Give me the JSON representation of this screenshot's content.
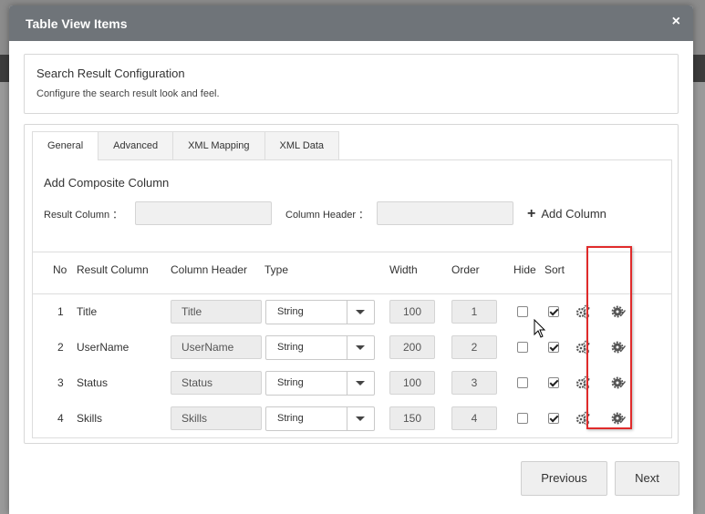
{
  "modal": {
    "title": "Table View Items",
    "close_glyph": "×"
  },
  "config": {
    "title": "Search Result Configuration",
    "description": "Configure the search result look and feel."
  },
  "tabs": [
    {
      "label": "General",
      "active": true
    },
    {
      "label": "Advanced",
      "active": false
    },
    {
      "label": "XML Mapping",
      "active": false
    },
    {
      "label": "XML Data",
      "active": false
    }
  ],
  "composite": {
    "title": "Add Composite Column",
    "result_column_label": "Result Column ：",
    "result_column_value": "",
    "column_header_label": "Column Header ：",
    "column_header_value": "",
    "add_button_label": "Add Column"
  },
  "table": {
    "headers": {
      "no": "No",
      "result_column": "Result Column",
      "column_header": "Column Header",
      "type": "Type",
      "width": "Width",
      "order": "Order",
      "hide": "Hide",
      "sort": "Sort"
    },
    "rows": [
      {
        "no": "1",
        "result_column": "Title",
        "column_header": "Title",
        "type": "String",
        "width": "100",
        "order": "1",
        "hide": false,
        "sort": true
      },
      {
        "no": "2",
        "result_column": "UserName",
        "column_header": "UserName",
        "type": "String",
        "width": "200",
        "order": "2",
        "hide": false,
        "sort": true
      },
      {
        "no": "3",
        "result_column": "Status",
        "column_header": "Status",
        "type": "String",
        "width": "100",
        "order": "3",
        "hide": false,
        "sort": true
      },
      {
        "no": "4",
        "result_column": "Skills",
        "column_header": "Skills",
        "type": "String",
        "width": "150",
        "order": "4",
        "hide": false,
        "sort": true
      }
    ]
  },
  "footer": {
    "previous_label": "Previous",
    "next_label": "Next"
  },
  "colors": {
    "header_bg": "#6f7479",
    "highlight": "#e02b2b"
  },
  "icons": {
    "settings": "gears-icon",
    "edit": "edit-settings-icon"
  }
}
